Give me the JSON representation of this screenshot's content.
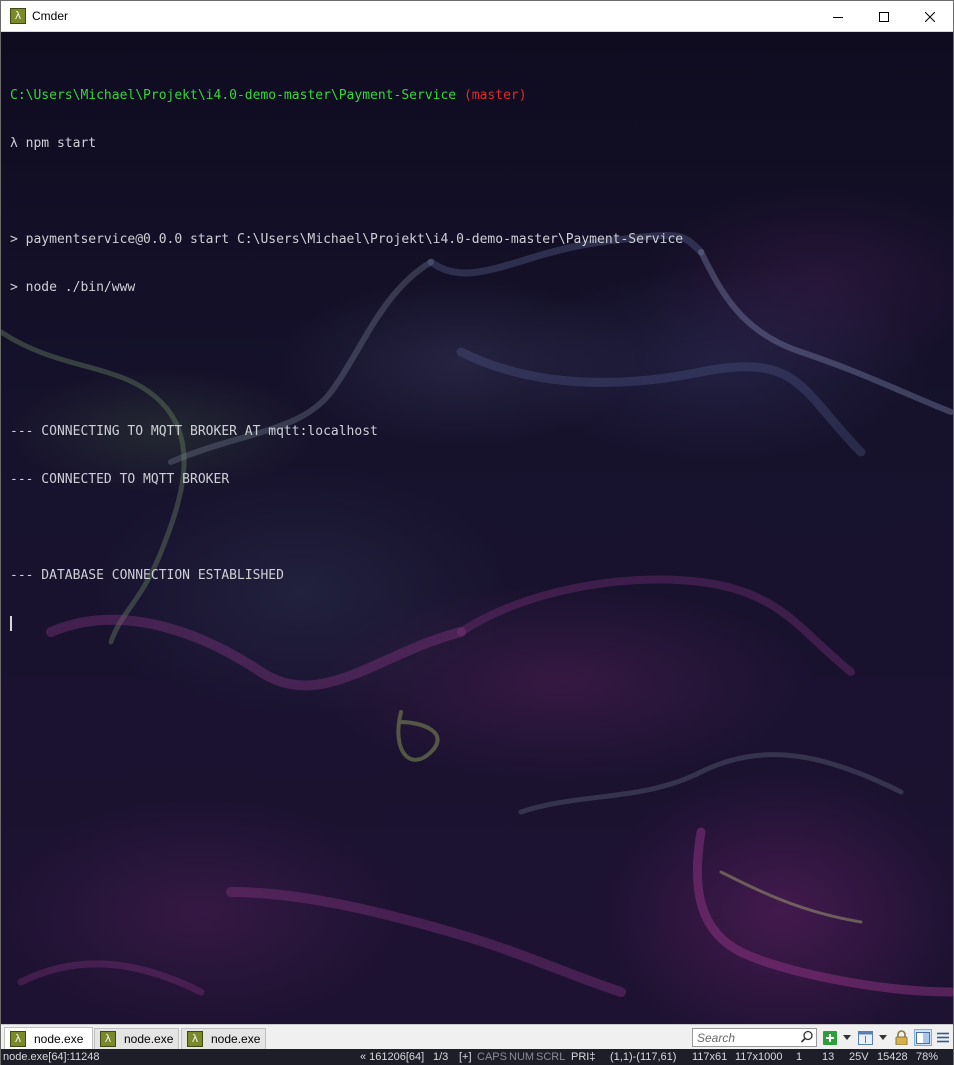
{
  "window": {
    "title": "Cmder",
    "app_icon_glyph": "λ",
    "icons": {
      "minimize": "minimize-icon",
      "maximize": "maximize-icon",
      "close": "close-icon"
    }
  },
  "terminal": {
    "prompt_path": "C:\\Users\\Michael\\Projekt\\i4.0-demo-master\\Payment-Service",
    "prompt_branch": " (master)",
    "command_line": "λ npm start",
    "output": [
      "> paymentservice@0.0.0 start C:\\Users\\Michael\\Projekt\\i4.0-demo-master\\Payment-Service",
      "> node ./bin/www",
      "--- CONNECTING TO MQTT BROKER AT mqtt:localhost",
      "--- CONNECTED TO MQTT BROKER",
      "--- DATABASE CONNECTION ESTABLISHED"
    ],
    "colors": {
      "path": "#35d63a",
      "branch": "#e02a2a",
      "text": "#cfcfd6"
    }
  },
  "tabs": [
    {
      "label": "node.exe",
      "icon_glyph": "λ",
      "active": true
    },
    {
      "label": "node.exe",
      "icon_glyph": "λ",
      "active": false
    },
    {
      "label": "node.exe",
      "icon_glyph": "λ",
      "active": false
    }
  ],
  "toolbar": {
    "search_placeholder": "Search",
    "icons": [
      "search-icon",
      "new-console-icon",
      "dropdown-icon",
      "console-list-icon",
      "dropdown-icon",
      "lock-icon",
      "split-view-icon",
      "menu-icon"
    ]
  },
  "status": {
    "process": "node.exe[64]:11248",
    "buffer": "« 161206[64]",
    "console_index": "1/3",
    "plus": "[+]",
    "caps": "CAPS",
    "num": "NUM",
    "scrl": "SCRL",
    "pri": "PRI‡",
    "selection": "(1,1)-(117,61)",
    "size": "117x61",
    "buffer_size": "117x1000",
    "field1": "1",
    "field2": "13",
    "field3": "25V",
    "field4": "15428",
    "zoom": "78%"
  }
}
